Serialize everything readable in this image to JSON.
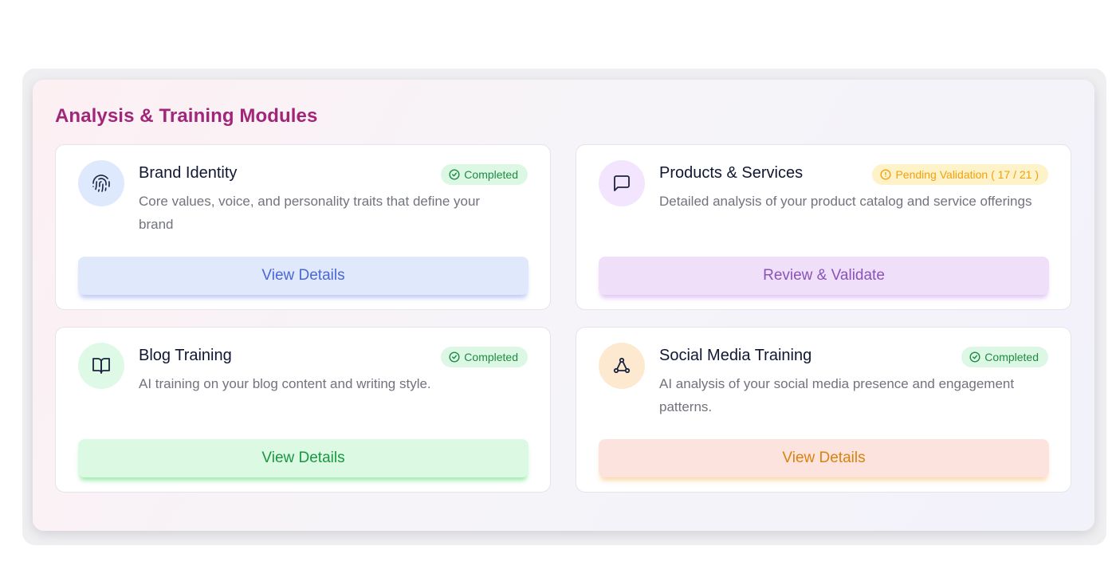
{
  "panel": {
    "title": "Analysis & Training Modules"
  },
  "modules": [
    {
      "title": "Brand Identity",
      "description": "Core values, voice, and personality traits that define your brand",
      "status": "Completed",
      "status_type": "completed",
      "action_label": "View Details",
      "icon": "fingerprint-icon",
      "icon_bg": "#dfe9fd",
      "accent": "#4a67d6"
    },
    {
      "title": "Products & Services",
      "description": "Detailed analysis of your product catalog and service offerings",
      "status": "Pending Validation ( 17 / 21 )",
      "status_type": "pending",
      "action_label": "Review & Validate",
      "icon": "message-square-icon",
      "icon_bg": "#f2e5fd",
      "accent": "#8a54b8"
    },
    {
      "title": "Blog Training",
      "description": "AI training on your blog content and writing style.",
      "status": "Completed",
      "status_type": "completed",
      "action_label": "View Details",
      "icon": "book-open-icon",
      "icon_bg": "#def9e6",
      "accent": "#1a9640"
    },
    {
      "title": "Social Media Training",
      "description": "AI analysis of your social media presence and engagement patterns.",
      "status": "Completed",
      "status_type": "completed",
      "action_label": "View Details",
      "icon": "network-triangle-icon",
      "icon_bg": "#fde9cf",
      "accent": "#d9820f"
    }
  ]
}
